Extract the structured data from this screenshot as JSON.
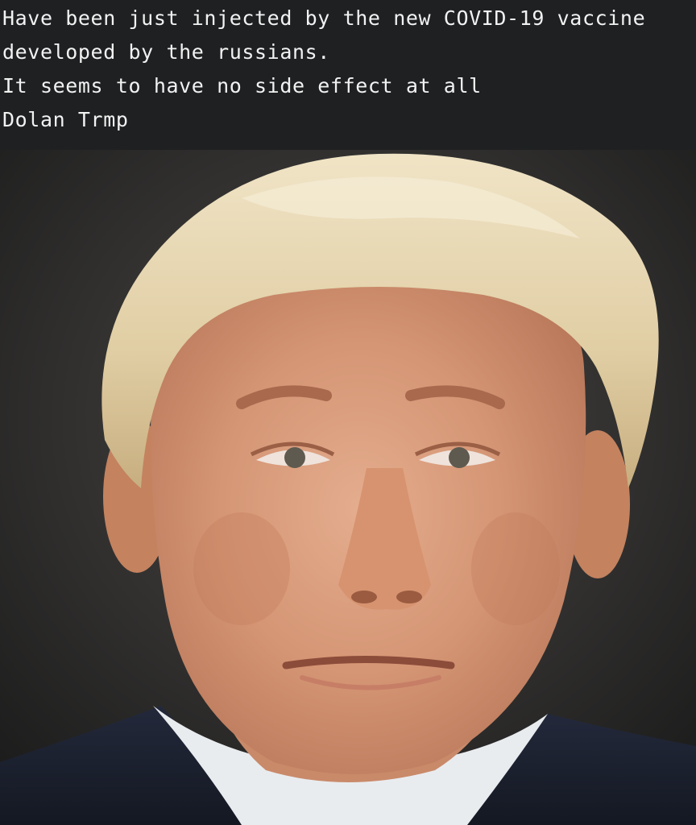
{
  "caption": {
    "lines": [
      "Have been just injected by the new COVID-19 vaccine",
      "developed by the russians.",
      "It seems to have no side effect at all",
      "Dolan Trmp"
    ]
  },
  "photo": {
    "description_icon": "portrait-photo",
    "colors": {
      "background": "#1d1f21",
      "hair": "#e6d6b0",
      "skin": "#d9a07f",
      "suit": "#1c2233",
      "shirt": "#eef0f2"
    }
  }
}
